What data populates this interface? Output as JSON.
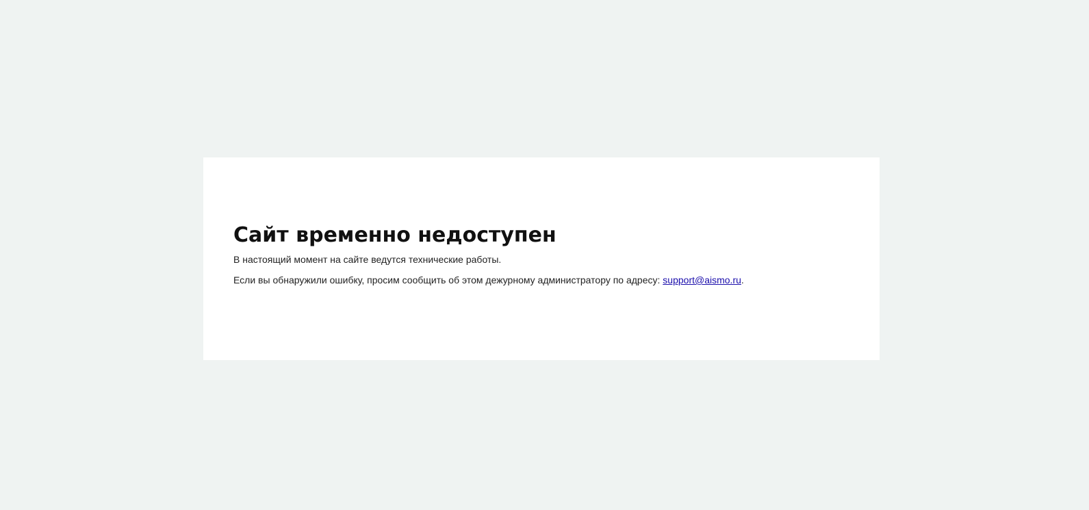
{
  "maintenance": {
    "title": "Сайт временно недоступен",
    "message": "В настоящий момент на сайте ведутся технические работы.",
    "report_text": "Если вы обнаружили ошибку, просим сообщить об этом дежурному администратору по адресу: ",
    "email": "support@aismo.ru",
    "trailing": "."
  }
}
